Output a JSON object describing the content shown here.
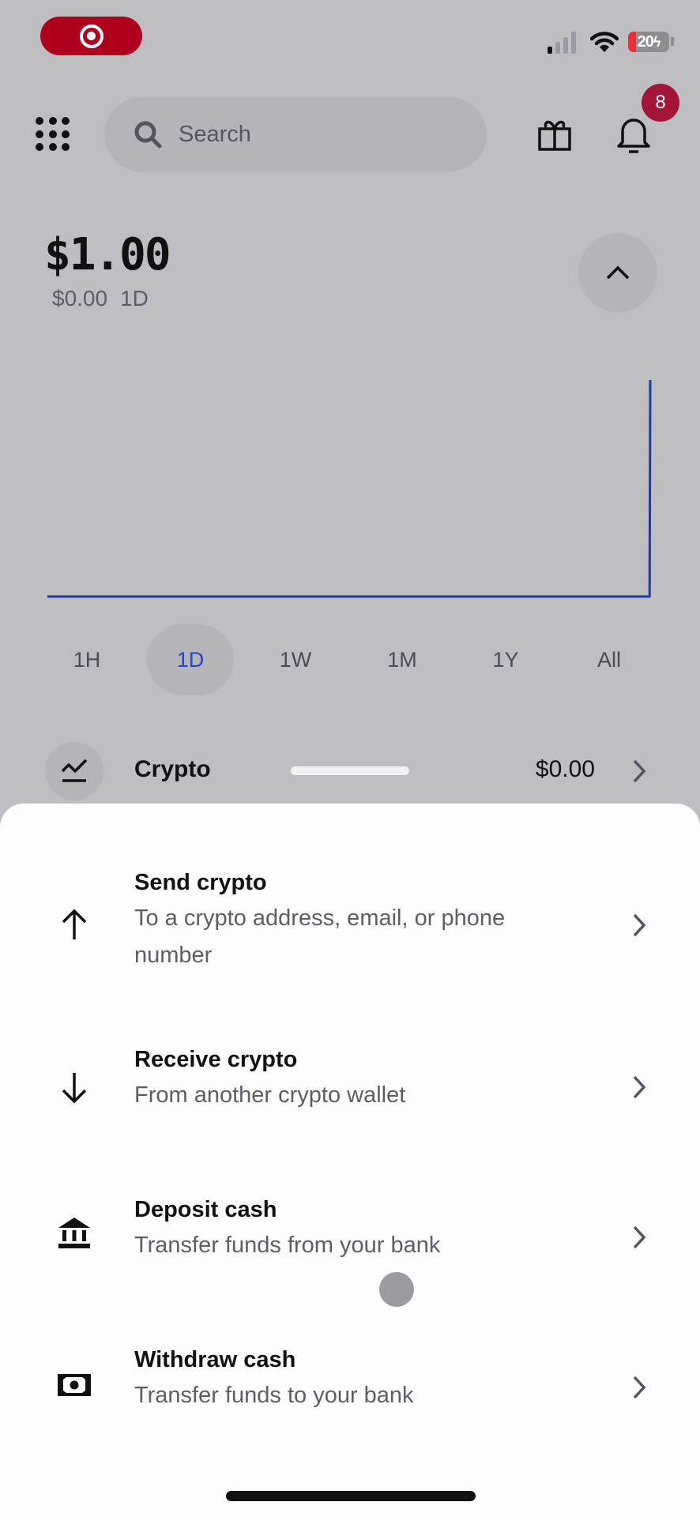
{
  "status_bar": {
    "app_indicator_icon": "target-record-icon",
    "app_indicator_color": "#b0001e",
    "signal_bars_active": 1,
    "signal_bars_total": 4,
    "battery_percent": 20,
    "battery_label": "20",
    "battery_charging": true
  },
  "header": {
    "menu_icon": "grid-icon",
    "search_placeholder": "Search",
    "gift_icon": "gift-icon",
    "notification_icon": "bell-icon",
    "notification_count": "8",
    "badge_color": "#a3153a"
  },
  "portfolio": {
    "balance": "$1.00",
    "change": "$0.00",
    "change_period": "1D",
    "collapse_icon": "chevron-up-icon"
  },
  "chart_data": {
    "type": "line",
    "title": "",
    "xlabel": "",
    "ylabel": "",
    "line_color": "#1f3a9e",
    "x": [
      0,
      0.999,
      1.0
    ],
    "values": [
      0,
      0,
      1.0
    ],
    "ylim": [
      0,
      1.0
    ],
    "grid": false
  },
  "time_ranges": {
    "options": [
      "1H",
      "1D",
      "1W",
      "1M",
      "1Y",
      "All"
    ],
    "selected": "1D",
    "active_color": "#2546c6"
  },
  "assets": [
    {
      "icon": "trending-chart-icon",
      "label": "Crypto",
      "value": "$0.00"
    }
  ],
  "actions_sheet": {
    "items": [
      {
        "icon": "arrow-up-icon",
        "title": "Send crypto",
        "subtitle": "To a crypto address, email, or phone number"
      },
      {
        "icon": "arrow-down-icon",
        "title": "Receive crypto",
        "subtitle": "From another crypto wallet"
      },
      {
        "icon": "bank-icon",
        "title": "Deposit cash",
        "subtitle": "Transfer funds from your bank"
      },
      {
        "icon": "cash-icon",
        "title": "Withdraw cash",
        "subtitle": "Transfer funds to your bank"
      }
    ]
  }
}
